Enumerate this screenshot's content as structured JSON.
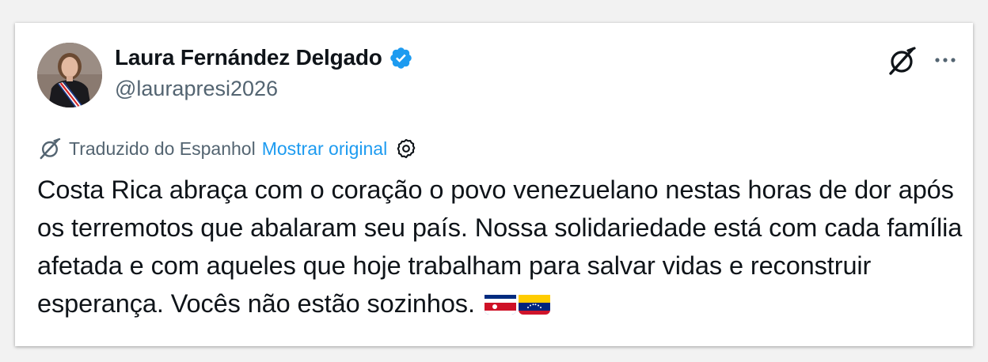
{
  "post": {
    "author_name": "Laura Fernández Delgado",
    "handle": "@laurapresi2026",
    "verified": true,
    "translation": {
      "label": "Traduzido do Espanhol",
      "show_original": "Mostrar original"
    },
    "text": "Costa Rica abraça com o coração o povo venezuelano nestas horas de dor após os terremotos que abalaram seu país. Nossa solidariedade está com cada família afetada e com aqueles que hoje trabalham para salvar vidas e reconstruir esperança. Vocês não estão sozinhos.",
    "flags": [
      "costa-rica-flag",
      "venezuela-flag"
    ]
  },
  "icons": {
    "verified": "verified-badge-icon",
    "grok": "grok-icon",
    "more": "more-options-icon",
    "translate": "grok-translate-icon",
    "settings": "gear-icon"
  },
  "colors": {
    "accent": "#1d9bf0",
    "text": "#0f1419",
    "secondary": "#536471"
  }
}
